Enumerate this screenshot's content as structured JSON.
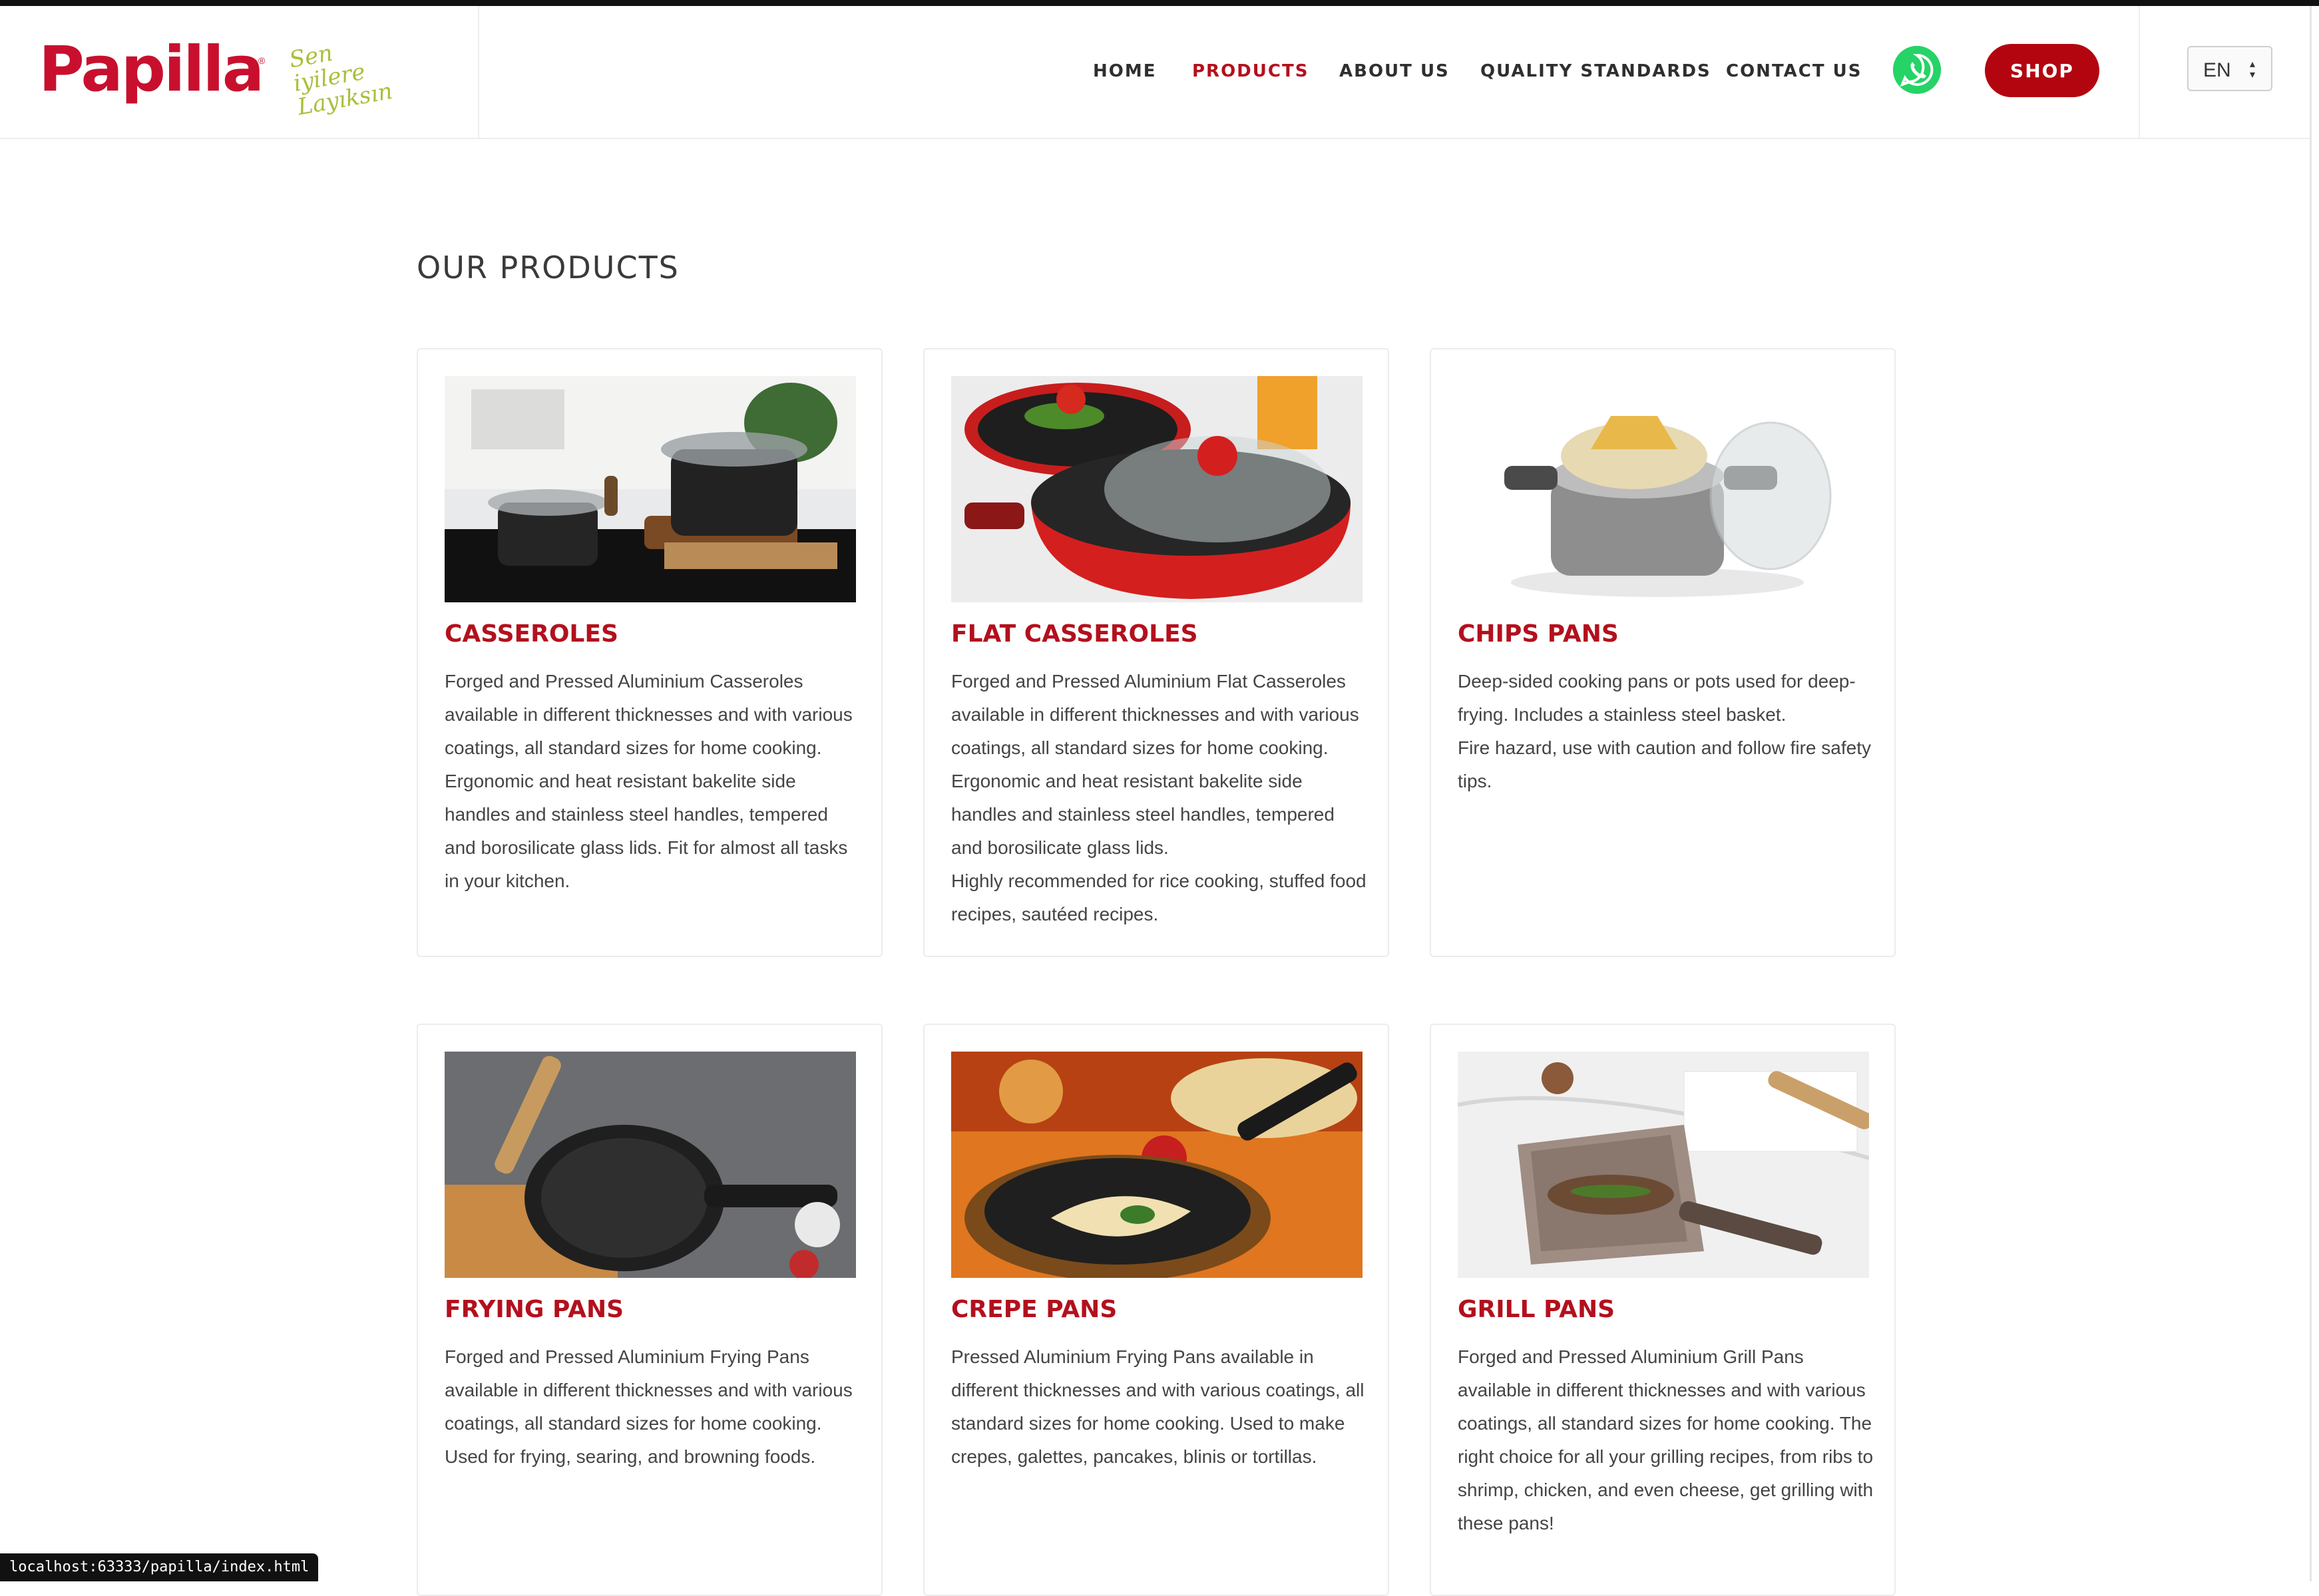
{
  "header": {
    "logo": "Papilla",
    "logo_tagline": "Sen iyilere Layıksın",
    "nav": [
      {
        "label": "HOME"
      },
      {
        "label": "PRODUCTS"
      },
      {
        "label": "ABOUT US"
      },
      {
        "label": "QUALITY STANDARDS"
      },
      {
        "label": "CONTACT US"
      }
    ],
    "active_nav": "PRODUCTS",
    "whatsapp_icon": "whatsapp-icon",
    "shop_label": "SHOP",
    "language": "EN"
  },
  "main": {
    "title": "OUR PRODUCTS",
    "products": [
      {
        "name": "CASSEROLES",
        "description": "Forged and Pressed Aluminium Casseroles available in different thicknesses and with various coatings, all standard sizes for home cooking. Ergonomic and heat resistant bakelite side handles and stainless steel handles, tempered and borosilicate glass lids. Fit for almost all tasks in your kitchen."
      },
      {
        "name": "FLAT CASSEROLES",
        "description": "Forged and Pressed Aluminium Flat Casseroles available in different thicknesses and with various coatings, all standard sizes for home cooking. Ergonomic and heat resistant bakelite side handles and stainless steel handles, tempered and borosilicate glass lids.",
        "description_2": "Highly recommended for rice cooking, stuffed food recipes, sautéed recipes."
      },
      {
        "name": "CHIPS PANS",
        "description": "Deep-sided cooking pans or pots used for deep-frying. Includes a stainless steel basket.",
        "description_2": "Fire hazard, use with caution and follow fire safety tips."
      },
      {
        "name": "FRYING PANS",
        "description": "Forged and Pressed Aluminium Frying Pans available in different thicknesses and with various coatings, all standard sizes for home cooking. Used for frying, searing, and browning foods."
      },
      {
        "name": "CREPE PANS",
        "description": "Pressed Aluminium Frying Pans available in different thicknesses and with various coatings, all standard sizes for home cooking. Used to make crepes, galettes, pancakes, blinis or tortillas."
      },
      {
        "name": "GRILL PANS",
        "description": "Forged and Pressed Aluminium Grill Pans available in different thicknesses and with various coatings, all standard sizes for home cooking. The right choice for all your grilling recipes, from ribs to shrimp, chicken, and even cheese, get grilling with these pans!"
      }
    ]
  },
  "status_url": "localhost:63333/papilla/index.html",
  "colors": {
    "brand_red": "#b3101d",
    "logo_red": "#c8102e",
    "tagline_green": "#a7c03a",
    "whatsapp_green": "#25d366"
  }
}
